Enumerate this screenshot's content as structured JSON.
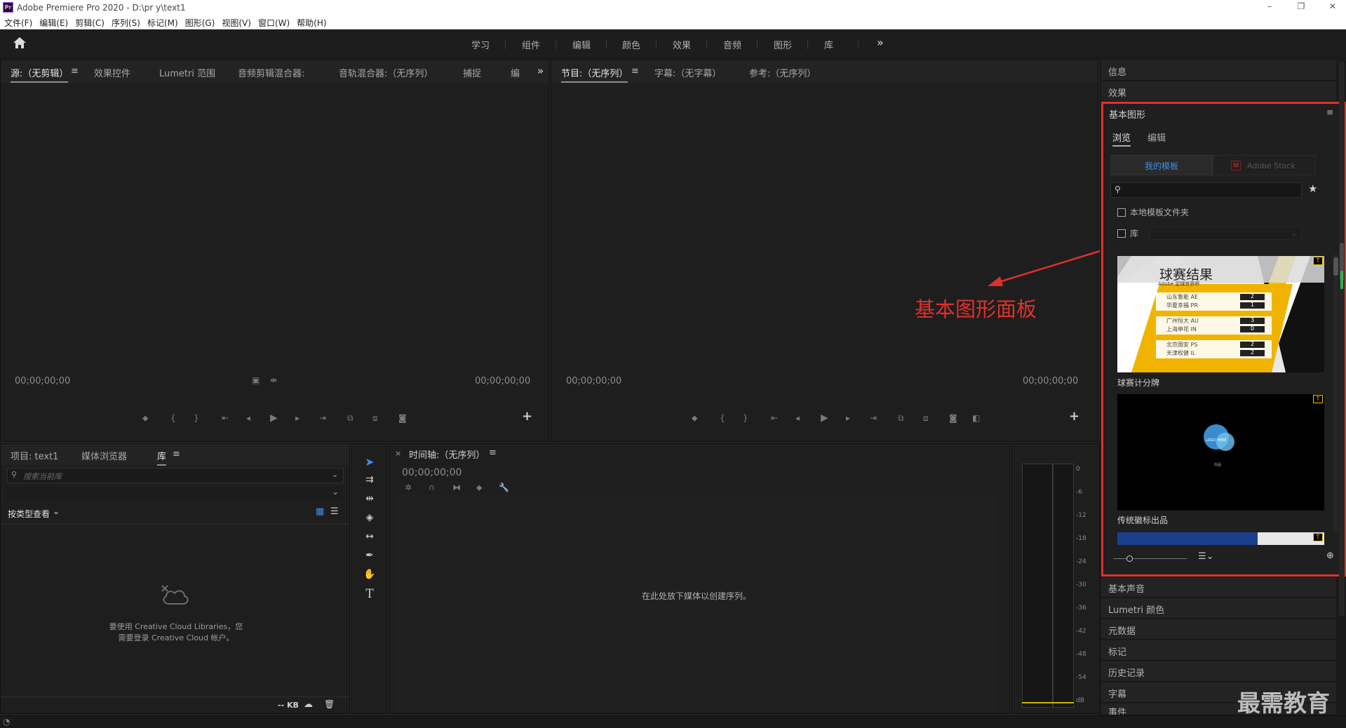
{
  "titlebar": {
    "logo": "Pr",
    "title": "Adobe Premiere Pro 2020 - D:\\pr y\\text1",
    "minimize": "–",
    "restore": "❐",
    "close": "✕"
  },
  "menu": [
    "文件(F)",
    "编辑(E)",
    "剪辑(C)",
    "序列(S)",
    "标记(M)",
    "图形(G)",
    "视图(V)",
    "窗口(W)",
    "帮助(H)"
  ],
  "workspaces": [
    "学习",
    "组件",
    "编辑",
    "颜色",
    "效果",
    "音频",
    "图形",
    "库"
  ],
  "workspace_more": "»",
  "source_panel": {
    "tabs": [
      "源:（无剪辑）",
      "效果控件",
      "Lumetri 范围",
      "音频剪辑混合器:",
      "音轨混合器:（无序列）",
      "捕捉",
      "编"
    ],
    "timecode_left": "00;00;00;00",
    "timecode_right": "00;00;00;00",
    "more": "»"
  },
  "program_panel": {
    "tabs": [
      "节目:（无序列）",
      "字幕:（无字幕）",
      "参考:（无序列）"
    ],
    "timecode_left": "00;00;00;00",
    "timecode_right": "00;00;00;00"
  },
  "project_panel": {
    "tabs": [
      "项目: text1",
      "媒体浏览器",
      "库"
    ],
    "search_placeholder": "搜索当前库",
    "view_label": "按类型查看",
    "message_line1": "要使用 Creative Cloud Libraries，您",
    "message_line2": "需要登录 Creative Cloud 帐户。",
    "size_label": "-- KB"
  },
  "timeline_panel": {
    "tab": "时间轴:（无序列）",
    "timecode": "00;00;00;00",
    "drop_message": "在此处放下媒体以创建序列。"
  },
  "meter_labels": [
    "0",
    "-6",
    "-12",
    "-18",
    "-24",
    "-30",
    "-36",
    "-42",
    "-48",
    "-54",
    "dB"
  ],
  "right_panel": {
    "top_items": [
      "信息",
      "效果"
    ],
    "essential_graphics": {
      "title": "基本图形",
      "tabs": [
        "浏览",
        "编辑"
      ],
      "source_tabs": [
        "我的模板",
        "Adobe Stock"
      ],
      "checkbox_local": "本地模板文件夹",
      "checkbox_lib": "库",
      "templates": [
        {
          "name": "球赛计分牌",
          "title": "球赛结果",
          "subtitle": "Adobe 足球世界杯",
          "rows": [
            [
              "山东鲁能 AE",
              "2"
            ],
            [
              "华夏幸福 PR",
              "1"
            ],
            [
              "广州恒大 AU",
              "3"
            ],
            [
              "上海申花 IN",
              "0"
            ],
            [
              "北京国安 PS",
              "2"
            ],
            [
              "天津权健 IL",
              "2"
            ]
          ]
        },
        {
          "name": "传统徽标出品",
          "logo_text": "LOGO HERE",
          "caption": "出品"
        }
      ]
    },
    "bottom_items": [
      "基本声音",
      "Lumetri 颜色",
      "元数据",
      "标记",
      "历史记录",
      "字幕",
      "事件"
    ]
  },
  "annotation": {
    "label": "基本图形面板",
    "color": "#e0302b"
  },
  "watermark": "最需教育"
}
